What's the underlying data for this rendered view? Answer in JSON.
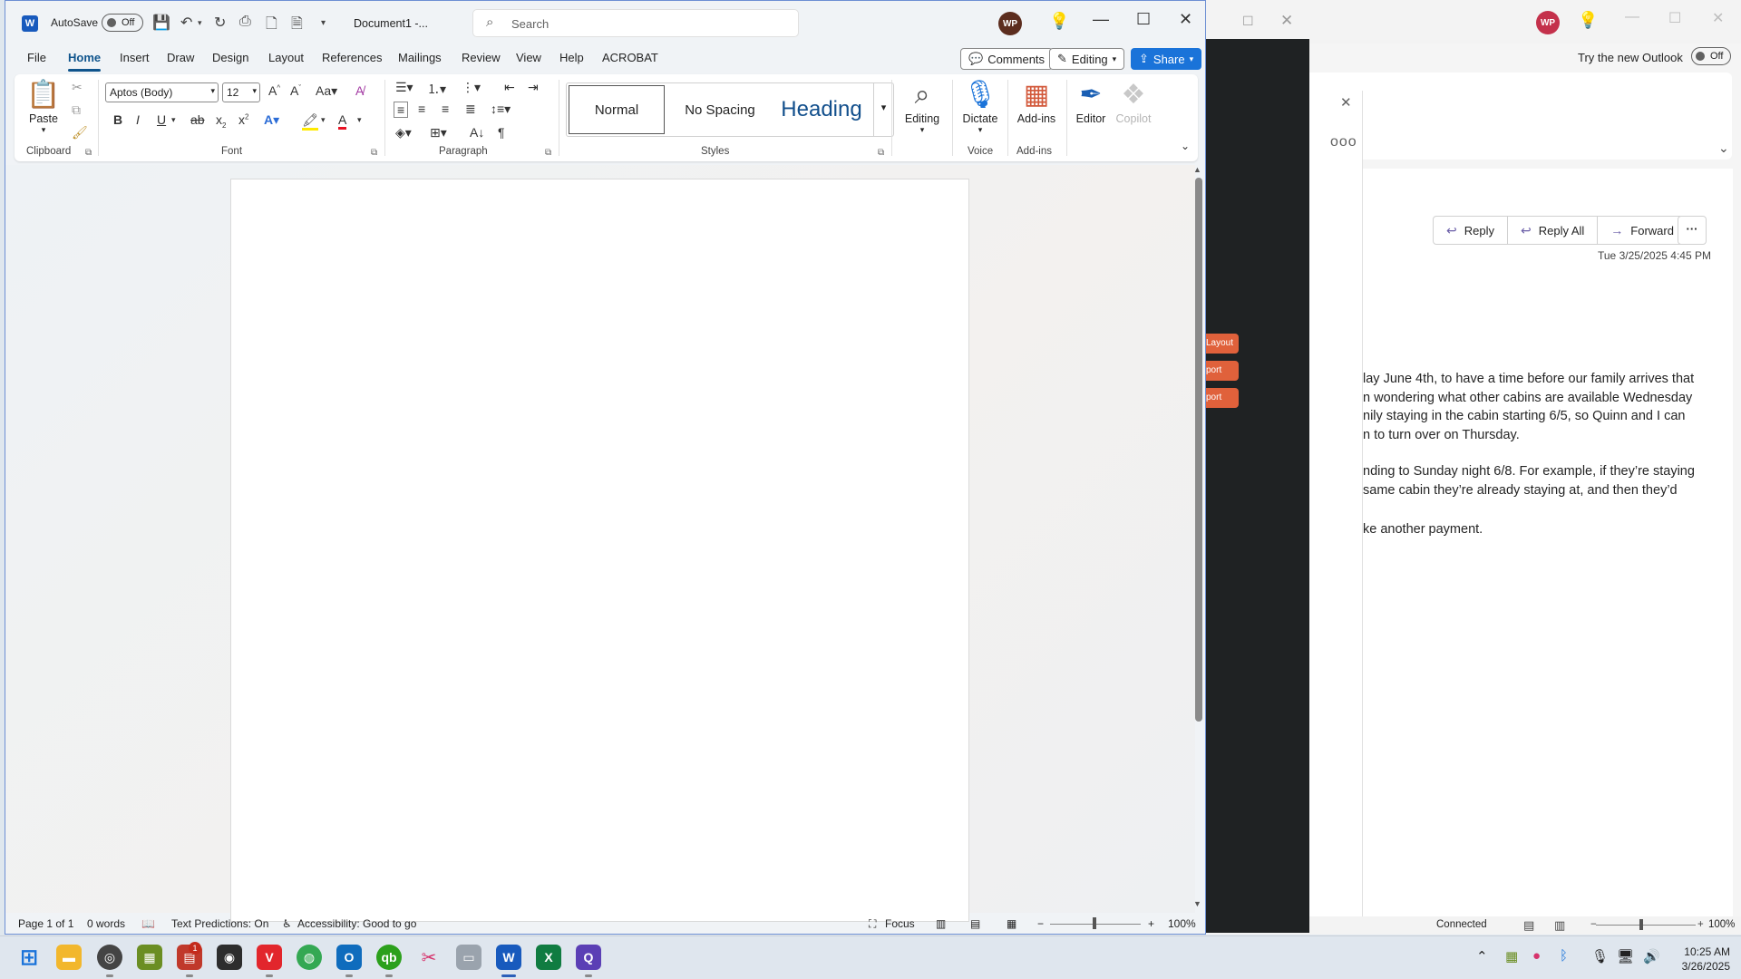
{
  "outlook": {
    "avatar": "WP",
    "try_new": "Try the new Outlook",
    "toggle": "Off",
    "actions": {
      "reply": "Reply",
      "reply_all": "Reply All",
      "forward": "Forward",
      "more": "···"
    },
    "date": "Tue 3/25/2025 4:45 PM",
    "body": [
      "lay June 4th, to have a time before our family arrives that",
      "n wondering what other cabins are available Wednesday",
      "nily staying in the cabin starting 6/5, so Quinn and I can",
      "n to turn over on Thursday.",
      "nding to Sunday night 6/8. For example, if they’re staying",
      "same cabin they’re already staying at, and then they’d",
      "ke another payment."
    ],
    "status": {
      "connected": "Connected",
      "zoom": "100%"
    }
  },
  "darkwin": {
    "tabs": [
      "Layout",
      "port",
      "port"
    ]
  },
  "word": {
    "autosave": "AutoSave",
    "autosave_state": "Off",
    "doc_name": "Document1  -...",
    "search_placeholder": "Search",
    "avatar": "WP",
    "tabs": [
      "File",
      "Home",
      "Insert",
      "Draw",
      "Design",
      "Layout",
      "References",
      "Mailings",
      "Review",
      "View",
      "Help",
      "ACROBAT"
    ],
    "comments": "Comments",
    "editing": "Editing",
    "share": "Share",
    "ribbon": {
      "paste": "Paste",
      "font_name": "Aptos (Body)",
      "font_size": "12",
      "styles": {
        "normal": "Normal",
        "no_spacing": "No Spacing",
        "heading": "Heading"
      },
      "editing": "Editing",
      "dictate": "Dictate",
      "addins": "Add-ins",
      "editor": "Editor",
      "copilot": "Copilot",
      "groups": {
        "clipboard": "Clipboard",
        "font": "Font",
        "paragraph": "Paragraph",
        "styles": "Styles",
        "voice": "Voice",
        "addins": "Add-ins"
      }
    },
    "status": {
      "page": "Page 1 of 1",
      "words": "0 words",
      "predictions": "Text Predictions: On",
      "accessibility": "Accessibility: Good to go",
      "focus": "Focus",
      "zoom": "100%"
    }
  },
  "taskbar": {
    "badge": "1",
    "clock_time": "10:25 AM",
    "clock_date": "3/26/2025"
  },
  "colors": {
    "word_blue": "#185abd",
    "accent": "#0f548c",
    "share": "#1a73d9",
    "outlook_avatar": "#c4314b"
  }
}
